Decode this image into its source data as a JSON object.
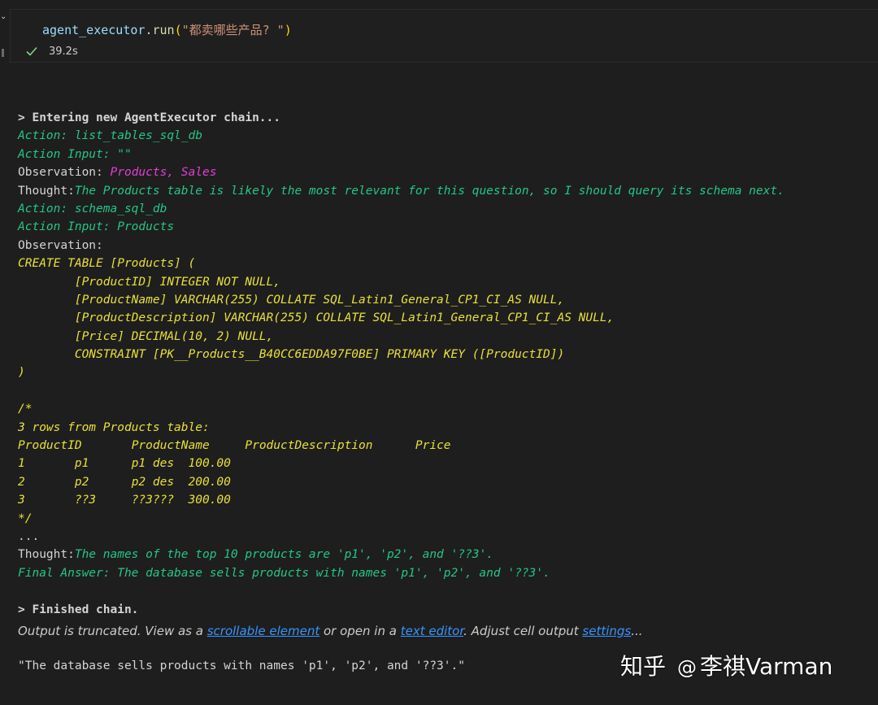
{
  "cell": {
    "code": {
      "object": "agent_executor",
      "dot": ".",
      "method": "run",
      "open_paren": "(",
      "argument": "\"都卖哪些产品? \"",
      "close_paren": ")"
    },
    "exec_time": "39.2s"
  },
  "output": {
    "lines": [
      {
        "name": "entering-chain-line",
        "segments": [
          {
            "text": "> Entering new AgentExecutor chain...",
            "style": "w b"
          }
        ]
      },
      {
        "name": "action-line",
        "segments": [
          {
            "text": "Action: list_tables_sql_db",
            "style": "g i"
          }
        ]
      },
      {
        "name": "action-input-line",
        "segments": [
          {
            "text": "Action Input: \"\"",
            "style": "g i"
          }
        ]
      },
      {
        "name": "observation-line",
        "segments": [
          {
            "text": "Observation: ",
            "style": "w"
          },
          {
            "text": "Products, Sales",
            "style": "m i"
          }
        ]
      },
      {
        "name": "thought-line",
        "segments": [
          {
            "text": "Thought:",
            "style": "w"
          },
          {
            "text": "The Products table is likely the most relevant for this question, so I should query its schema next.",
            "style": "g i"
          }
        ]
      },
      {
        "name": "action-line",
        "segments": [
          {
            "text": "Action: schema_sql_db",
            "style": "g i"
          }
        ]
      },
      {
        "name": "action-input-line",
        "segments": [
          {
            "text": "Action Input: Products",
            "style": "g i"
          }
        ]
      },
      {
        "name": "observation-line",
        "segments": [
          {
            "text": "Observation:",
            "style": "w"
          }
        ]
      },
      {
        "name": "schema-line",
        "segments": [
          {
            "text": "CREATE TABLE [Products] (",
            "style": "y i"
          }
        ]
      },
      {
        "name": "schema-line",
        "segments": [
          {
            "text": "        [ProductID] INTEGER NOT NULL,",
            "style": "y i"
          }
        ]
      },
      {
        "name": "schema-line",
        "segments": [
          {
            "text": "        [ProductName] VARCHAR(255) COLLATE SQL_Latin1_General_CP1_CI_AS NULL,",
            "style": "y i"
          }
        ]
      },
      {
        "name": "schema-line",
        "segments": [
          {
            "text": "        [ProductDescription] VARCHAR(255) COLLATE SQL_Latin1_General_CP1_CI_AS NULL,",
            "style": "y i"
          }
        ]
      },
      {
        "name": "schema-line",
        "segments": [
          {
            "text": "        [Price] DECIMAL(10, 2) NULL,",
            "style": "y i"
          }
        ]
      },
      {
        "name": "schema-line",
        "segments": [
          {
            "text": "        CONSTRAINT [PK__Products__B40CC6EDDA97F0BE] PRIMARY KEY ([ProductID])",
            "style": "y i"
          }
        ]
      },
      {
        "name": "schema-line",
        "segments": [
          {
            "text": ")",
            "style": "y i"
          }
        ]
      },
      {
        "name": "blank-line",
        "segments": []
      },
      {
        "name": "schema-line",
        "segments": [
          {
            "text": "/*",
            "style": "y i"
          }
        ]
      },
      {
        "name": "schema-line",
        "segments": [
          {
            "text": "3 rows from Products table:",
            "style": "y i"
          }
        ]
      },
      {
        "name": "schema-line",
        "segments": [
          {
            "text": "ProductID\tProductName\tProductDescription\tPrice",
            "style": "y i"
          }
        ]
      },
      {
        "name": "schema-line",
        "segments": [
          {
            "text": "1\tp1\tp1 des\t100.00",
            "style": "y i"
          }
        ]
      },
      {
        "name": "schema-line",
        "segments": [
          {
            "text": "2\tp2\tp2 des\t200.00",
            "style": "y i"
          }
        ]
      },
      {
        "name": "schema-line",
        "segments": [
          {
            "text": "3\t??3\t??3???\t300.00",
            "style": "y i"
          }
        ]
      },
      {
        "name": "schema-line",
        "segments": [
          {
            "text": "*/",
            "style": "y i"
          }
        ]
      },
      {
        "name": "ellipsis-line",
        "segments": [
          {
            "text": "...",
            "style": "w"
          }
        ]
      },
      {
        "name": "thought-line",
        "segments": [
          {
            "text": "Thought:",
            "style": "w"
          },
          {
            "text": "The names of the top 10 products are 'p1', 'p2', and '??3'.",
            "style": "g i"
          }
        ]
      },
      {
        "name": "final-answer-line",
        "segments": [
          {
            "text": "Final Answer: The database sells products with names 'p1', 'p2', and '??3'.",
            "style": "g i"
          }
        ]
      },
      {
        "name": "blank-line",
        "segments": []
      },
      {
        "name": "finished-chain-line",
        "segments": [
          {
            "text": "> Finished chain.",
            "style": "w b"
          }
        ]
      }
    ]
  },
  "truncation_notice": {
    "prefix": "Output is truncated. View as a ",
    "scrollable_link": "scrollable element",
    "middle": " or open in a ",
    "editor_link": "text editor",
    "suffix_before": ". Adjust cell output ",
    "settings_link": "settings",
    "suffix": "..."
  },
  "result_text": "\"The database sells products with names 'p1', 'p2', and '??3'.\"",
  "watermark": {
    "logo": "知乎",
    "at": "@",
    "name": "李祺Varman"
  },
  "colors": {
    "background": "#1e1e1e",
    "green": "#24c686",
    "magenta": "#e23ed8",
    "yellow": "#e8e038",
    "link": "#3794ff"
  },
  "icons": {
    "cell_status": "check-icon",
    "collapse": "chevron-icon"
  }
}
